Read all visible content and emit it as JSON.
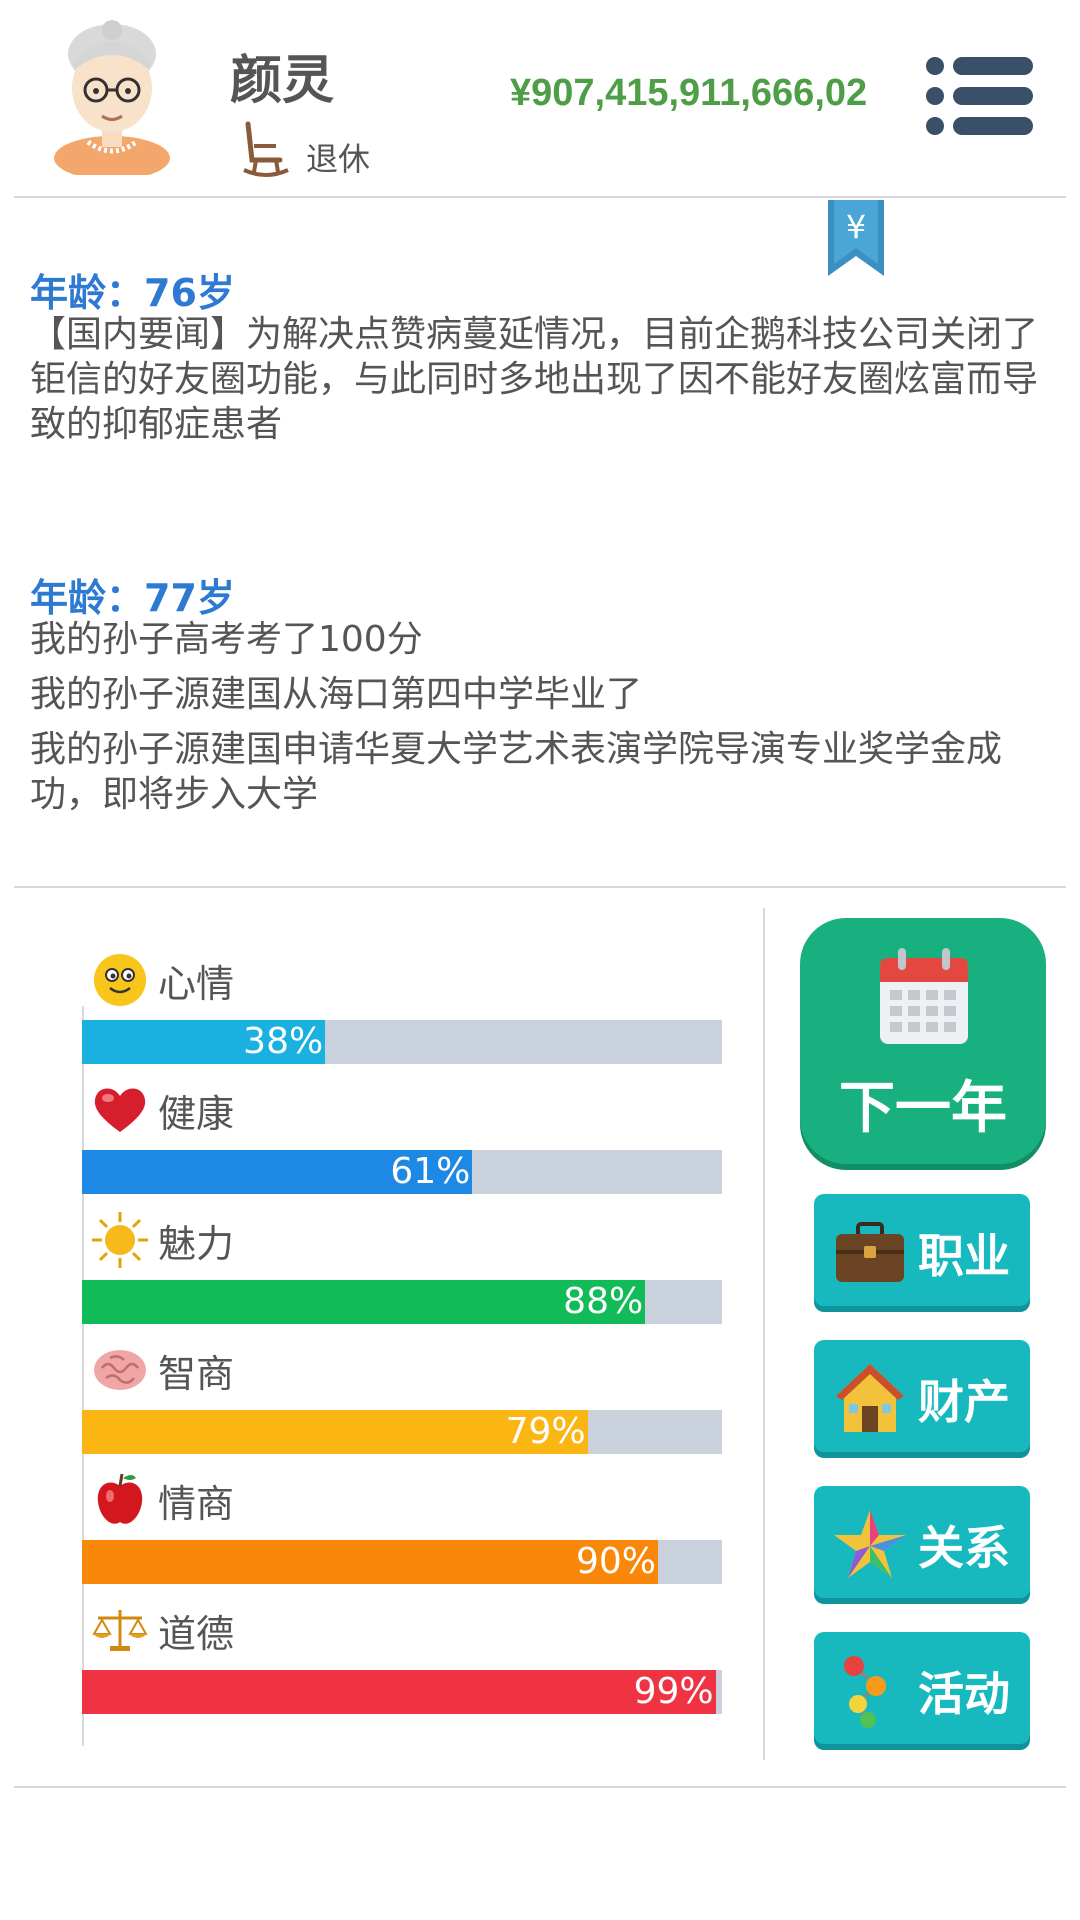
{
  "header": {
    "name": "颜灵",
    "status": "退休",
    "money": "¥907,415,911,666,02"
  },
  "log": [
    {
      "age": "年龄：76岁",
      "lines": [
        "【国内要闻】为解决点赞病蔓延情况，目前企鹅科技公司关闭了钜信的好友圈功能，与此同时多地出现了因不能好友圈炫富而导致的抑郁症患者"
      ]
    },
    {
      "age": "年龄：77岁",
      "lines": [
        "我的孙子高考考了100分",
        "我的孙子源建国从海口第四中学毕业了",
        "我的孙子源建国申请华夏大学艺术表演学院导演专业奖学金成功，即将步入大学"
      ]
    }
  ],
  "stats": [
    {
      "label": "心情",
      "pct_text": "38%",
      "value": 38,
      "color": "#1ab1e0",
      "icon": "smiley-face-icon"
    },
    {
      "label": "健康",
      "pct_text": "61%",
      "value": 61,
      "color": "#1e88e5",
      "icon": "heart-icon"
    },
    {
      "label": "魅力",
      "pct_text": "88%",
      "value": 88,
      "color": "#10bb58",
      "icon": "sun-icon"
    },
    {
      "label": "智商",
      "pct_text": "79%",
      "value": 79,
      "color": "#fbb614",
      "icon": "brain-icon"
    },
    {
      "label": "情商",
      "pct_text": "90%",
      "value": 90,
      "color": "#f9870a",
      "icon": "apple-icon"
    },
    {
      "label": "道德",
      "pct_text": "99%",
      "value": 99,
      "color": "#ef3343",
      "icon": "scales-icon"
    }
  ],
  "actions": {
    "next_year": "下一年",
    "career": "职业",
    "property": "财产",
    "relations": "关系",
    "activities": "活动"
  }
}
